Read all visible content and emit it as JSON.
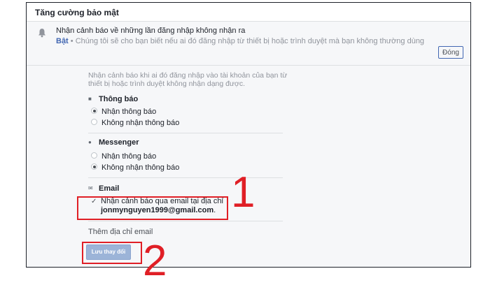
{
  "section": {
    "title": "Tăng cường bảo mật"
  },
  "alert": {
    "title": "Nhận cảnh báo về những lần đăng nhập không nhận ra",
    "status": "Bật",
    "separator": " • ",
    "subtitle": "Chúng tôi sẽ cho bạn biết nếu ai đó đăng nhập từ thiết bị hoặc trình duyệt mà bạn không thường dùng",
    "close_label": "Đóng"
  },
  "settings": {
    "description": "Nhận cảnh báo khi ai đó đăng nhập vào tài khoản của bạn từ thiết bị hoặc trình duyệt không nhận dạng được.",
    "notifications": {
      "title": "Thông báo",
      "options": [
        "Nhận thông báo",
        "Không nhận thông báo"
      ],
      "selected": 0
    },
    "messenger": {
      "title": "Messenger",
      "options": [
        "Nhận thông báo",
        "Không nhận thông báo"
      ],
      "selected": 1
    },
    "email": {
      "title": "Email",
      "checkbox_label": "Nhận cảnh báo qua email tại địa chỉ",
      "address": "jonmynguyen1999@gmail.com",
      "address_suffix": ".",
      "checked": true
    },
    "add_email_label": "Thêm địa chỉ email",
    "save_label": "Lưu thay đổi"
  },
  "annotations": {
    "step1": "1",
    "step2": "2",
    "color": "#e01f26"
  },
  "icons": {
    "alert": "bell-icon",
    "notifications": "notification-icon",
    "messenger": "messenger-icon",
    "email": "envelope-icon"
  }
}
